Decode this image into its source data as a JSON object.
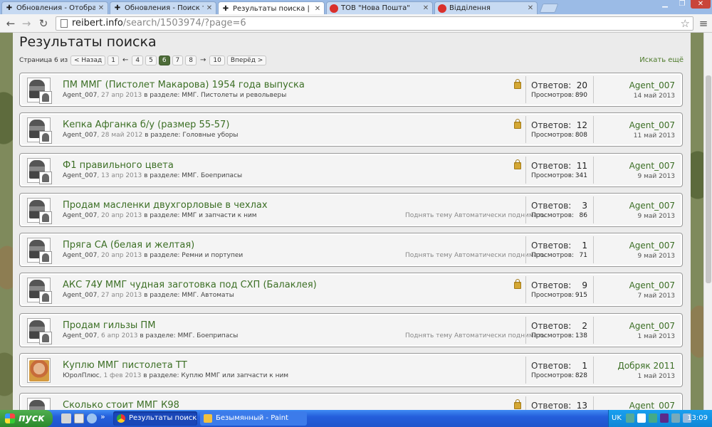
{
  "browser": {
    "tabs": [
      {
        "title": "Обновления - Отображение",
        "icon": "reibert-cross-icon",
        "active": false
      },
      {
        "title": "Обновления - Поиск тем по",
        "icon": "reibert-cross-icon",
        "active": false
      },
      {
        "title": "Результаты поиска | REIBE",
        "icon": "reibert-cross-icon",
        "active": true
      },
      {
        "title": "ТОВ \"Нова Пошта\"",
        "icon": "nova-poshta-icon",
        "active": false
      },
      {
        "title": "Відділення",
        "icon": "nova-poshta-icon",
        "active": false
      }
    ],
    "url_host": "reibert.info",
    "url_path": "/search/1503974/?page=6"
  },
  "page": {
    "title": "Результаты поиска",
    "pager_label": "Страница 6 из 10",
    "pager": [
      "< Назад",
      "1",
      "←",
      "4",
      "5",
      "6",
      "7",
      "8",
      "→",
      "10",
      "Вперёд >"
    ],
    "current_page": "6",
    "search_more": "Искать ещё"
  },
  "labels": {
    "replies": "Ответов:",
    "views": "Просмотров:",
    "in_section": "в разделе:"
  },
  "results": [
    {
      "title": "ПМ ММГ (Пистолет Макарова) 1954 года выпуска",
      "author": "Agent_007",
      "date": "27 апр 2013",
      "section": "ММГ. Пистолеты и револьверы",
      "locked": true,
      "bump": "",
      "replies": "20",
      "views": "890",
      "last_user": "Agent_007",
      "last_date": "14 май 2013",
      "avatar": "alt0"
    },
    {
      "title": "Кепка Афганка б/у (размер 55-57)",
      "author": "Agent_007",
      "date": "28 май 2012",
      "section": "Головные уборы",
      "locked": true,
      "bump": "",
      "replies": "12",
      "views": "808",
      "last_user": "Agent_007",
      "last_date": "11 май 2013",
      "avatar": "alt0"
    },
    {
      "title": "Ф1 правильного цвета",
      "author": "Agent_007",
      "date": "13 апр 2013",
      "section": "ММГ. Боеприпасы",
      "locked": true,
      "bump": "",
      "replies": "11",
      "views": "341",
      "last_user": "Agent_007",
      "last_date": "9 май 2013",
      "avatar": "alt0"
    },
    {
      "title": "Продам масленки двухгорловые в чехлах",
      "author": "Agent_007",
      "date": "20 апр 2013",
      "section": "ММГ и запчасти к ним",
      "locked": false,
      "bump": "Поднять тему Автоматически поднимать",
      "replies": "3",
      "views": "86",
      "last_user": "Agent_007",
      "last_date": "9 май 2013",
      "avatar": "alt0"
    },
    {
      "title": "Пряга СА (белая и желтая)",
      "author": "Agent_007",
      "date": "20 апр 2013",
      "section": "Ремни и портупеи",
      "locked": false,
      "bump": "Поднять тему Автоматически поднимать",
      "replies": "1",
      "views": "71",
      "last_user": "Agent_007",
      "last_date": "9 май 2013",
      "avatar": "alt0"
    },
    {
      "title": "АКС 74У ММГ чудная заготовка под СХП (Балаклея)",
      "author": "Agent_007",
      "date": "27 апр 2013",
      "section": "ММГ. Автоматы",
      "locked": true,
      "bump": "",
      "replies": "9",
      "views": "915",
      "last_user": "Agent_007",
      "last_date": "7 май 2013",
      "avatar": "alt0"
    },
    {
      "title": "Продам гильзы ПМ",
      "author": "Agent_007",
      "date": "6 апр 2013",
      "section": "ММГ. Боеприпасы",
      "locked": false,
      "bump": "Поднять тему Автоматически поднимать",
      "replies": "2",
      "views": "138",
      "last_user": "Agent_007",
      "last_date": "1 май 2013",
      "avatar": "alt0"
    },
    {
      "title": "Куплю ММГ пистолета ТТ",
      "author": "ЮролПлюс",
      "date": "1 фев 2013",
      "section": "Куплю ММГ или запчасти к ним",
      "locked": false,
      "bump": "",
      "replies": "1",
      "views": "828",
      "last_user": "Добряк 2011",
      "last_date": "1 май 2013",
      "avatar": "alt1"
    },
    {
      "title": "Сколько стоит ММГ К98",
      "author": "",
      "date": "",
      "section": "",
      "locked": true,
      "bump": "",
      "replies": "13",
      "views": "",
      "last_user": "Agent_007",
      "last_date": "",
      "avatar": "alt0"
    }
  ],
  "taskbar": {
    "start": "пуск",
    "tasks": [
      {
        "title": "Результаты поиска ...",
        "icon": "chrome-icon",
        "active": true
      },
      {
        "title": "Безымянный - Paint",
        "icon": "paint-icon",
        "active": false
      }
    ],
    "lang": "UK",
    "clock": "13:09"
  },
  "colors": {
    "link_green": "#3c6f25",
    "current_page_bg": "#4d6b38",
    "taskbar_blue": "#245edb",
    "start_green": "#2c8a2c"
  }
}
